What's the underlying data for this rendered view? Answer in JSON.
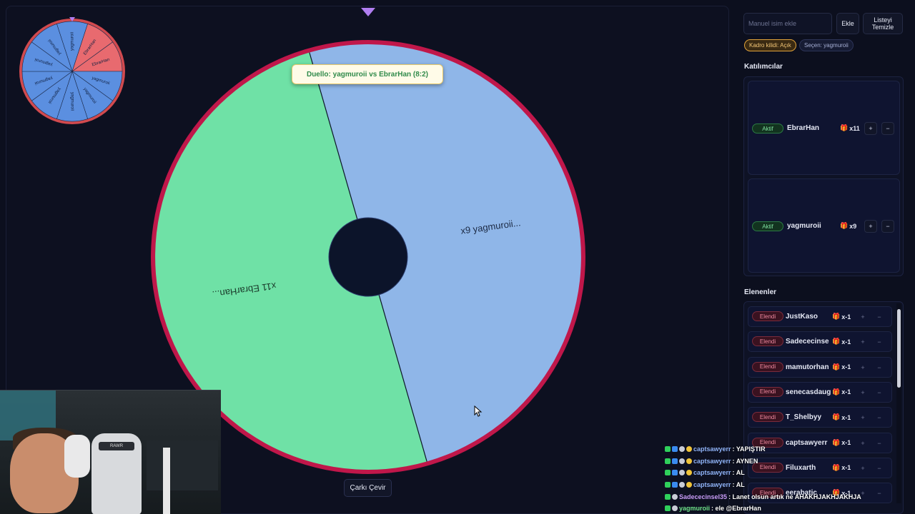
{
  "wheel": {
    "duel_toast": "Duello: yagmuroii vs EbrarHan (8:2)",
    "spin_label": "Çarkı Çevir",
    "labels": {
      "left": "x11 EbrarHan...",
      "right": "x9 yagmuroii..."
    },
    "colors": {
      "left": "#6fe1a6",
      "right": "#8fb6e8",
      "rim": "#c0174a",
      "hub": "#0c142a"
    },
    "mini": {
      "segments": [
        "yagmuroii",
        "EbrarHan",
        "EbrarHan",
        "yagmuroii",
        "yagmuroii",
        "yagmuroii",
        "yagmuroii",
        "yagmuroii",
        "yagmuroii",
        "yagmuroii"
      ],
      "colors": {
        "yagmuroii": "#5b8fe0",
        "EbrarHan": "#e86a6f"
      }
    }
  },
  "panel": {
    "input_placeholder": "Manuel isim ekle",
    "add_label": "Ekle",
    "clear_label_line1": "Listeyi",
    "clear_label_line2": "Temizle",
    "lock_pill": "Kadro kilidi: Açık",
    "picker_pill": "Seçen: yagmuroii",
    "participants_title": "Katılımcılar",
    "eliminated_title": "Elenenler",
    "participants": [
      {
        "status": "Aktif",
        "name": "EbrarHan",
        "count": "x11",
        "plus": "+",
        "minus": "−"
      },
      {
        "status": "Aktif",
        "name": "yagmuroii",
        "count": "x9",
        "plus": "+",
        "minus": "−"
      }
    ],
    "eliminated": [
      {
        "status": "Elendi",
        "name": "JustKaso",
        "count": "x-1"
      },
      {
        "status": "Elendi",
        "name": "Sadececinse",
        "count": "x-1"
      },
      {
        "status": "Elendi",
        "name": "mamutorhan",
        "count": "x-1"
      },
      {
        "status": "Elendi",
        "name": "senecasdaug",
        "count": "x-1"
      },
      {
        "status": "Elendi",
        "name": "T_Shelbyy",
        "count": "x-1"
      },
      {
        "status": "Elendi",
        "name": "captsawyerr",
        "count": "x-1"
      },
      {
        "status": "Elendi",
        "name": "Filuxarth",
        "count": "x-1"
      },
      {
        "status": "Elendi",
        "name": "eerabatic",
        "count": "x-1"
      }
    ],
    "row_plus": "+",
    "row_minus": "−"
  },
  "chat": [
    {
      "user": "captsawyerr",
      "msg": ": YAPIŞTIR",
      "style": "blue"
    },
    {
      "user": "captsawyerr",
      "msg": ": AYNEN",
      "style": "blue"
    },
    {
      "user": "captsawyerr",
      "msg": ": AL",
      "style": "blue"
    },
    {
      "user": "captsawyerr",
      "msg": ": AL",
      "style": "blue"
    },
    {
      "user": "Sadececinsel35",
      "msg": ": Lanet olsun artık ne AHAKHJAKHJAKHJA",
      "style": "purple"
    },
    {
      "user": "yagmuroii",
      "msg": ": ele @EbrarHan",
      "style": "green"
    }
  ],
  "webcam": {
    "chair_logo": "RAWR"
  }
}
